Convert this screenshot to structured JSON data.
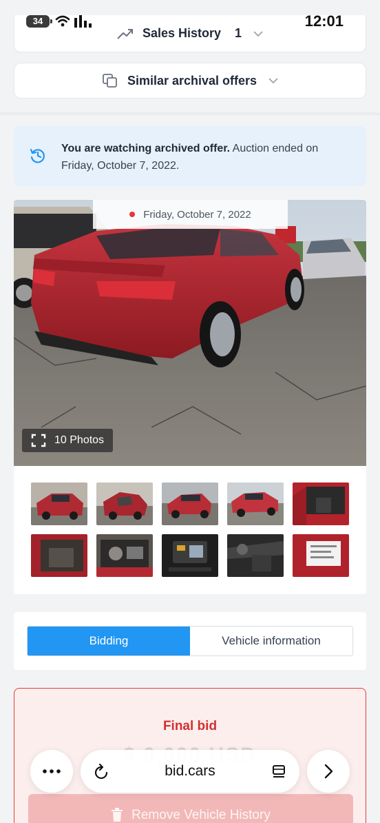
{
  "status_bar": {
    "battery": "34",
    "time": "12:01"
  },
  "sales_history": {
    "label": "Sales History",
    "count": "1"
  },
  "similar_offers": {
    "label": "Similar archival offers"
  },
  "notice": {
    "bold": "You are watching archived offer.",
    "rest": " Auction ended on Friday, October 7, 2022."
  },
  "gallery": {
    "date": "Friday, October 7, 2022",
    "photos_button": "10 Photos",
    "thumbnails": [
      "rear-quarter-left",
      "front-damage",
      "rear-left",
      "rear-right",
      "interior-driver",
      "interior-rear",
      "engine-bay",
      "dashboard-screen",
      "center-console",
      "window-sticker"
    ]
  },
  "tabs": {
    "bidding": "Bidding",
    "vehicle_info": "Vehicle information"
  },
  "final_bid": {
    "label": "Final bid",
    "amount": "$ 0,000 USD"
  },
  "remove_history": {
    "label": "Remove Vehicle History"
  },
  "browser": {
    "url": "bid.cars"
  },
  "colors": {
    "accent": "#2196f3",
    "alert": "#d32f2f",
    "notice_bg": "#e6f1fb"
  }
}
